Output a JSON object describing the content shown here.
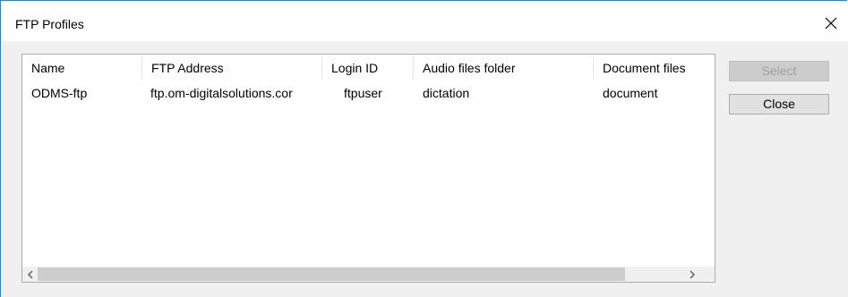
{
  "window": {
    "title": "FTP Profiles"
  },
  "table": {
    "columns": [
      {
        "label": "Name"
      },
      {
        "label": "FTP Address"
      },
      {
        "label": "Login ID"
      },
      {
        "label": "Audio files folder"
      },
      {
        "label": "Document files"
      }
    ],
    "rows": [
      {
        "name": "ODMS-ftp",
        "ftp_address": "ftp.om-digitalsolutions.cor",
        "login_id": "ftpuser",
        "audio_folder": "dictation",
        "document_folder": "document"
      }
    ]
  },
  "buttons": {
    "select": {
      "label": "Select",
      "enabled": false
    },
    "close": {
      "label": "Close",
      "enabled": true
    }
  },
  "icons": {
    "close": "close-icon",
    "scroll_left": "chevron-left-icon",
    "scroll_right": "chevron-right-icon"
  },
  "colors": {
    "window_border": "#3c7fb1",
    "dialog_bg": "#f0f0f0",
    "button_bg": "#e1e1e1",
    "disabled_text": "#a0a0a0",
    "scroll_thumb": "#cdcdcd"
  }
}
